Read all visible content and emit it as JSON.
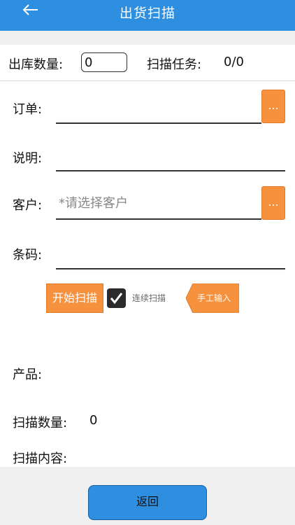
{
  "header": {
    "title": "出货扫描",
    "back_icon": "arrow-left-icon"
  },
  "qty_row": {
    "out_qty_label": "出库数量:",
    "out_qty_value": "0",
    "task_label": "扫描任务:",
    "task_value": "0/0"
  },
  "form": {
    "order_label": "订单:",
    "order_button": "...",
    "desc_label": "说明:",
    "customer_label": "客户:",
    "customer_placeholder": "*请选择客户",
    "customer_button": "...",
    "barcode_label": "条码:"
  },
  "scan_controls": {
    "start_scan": "开始扫描",
    "continuous_checked": true,
    "continuous_label": "连续扫描",
    "manual_input": "手工输入"
  },
  "info": {
    "product_label": "产品:",
    "scan_qty_label": "扫描数量:",
    "scan_qty_value": "0",
    "scan_content_label": "扫描内容:"
  },
  "footer": {
    "return_button": "返回"
  },
  "colors": {
    "header": "#2e8ee0",
    "accent_orange": "#f6913d"
  }
}
